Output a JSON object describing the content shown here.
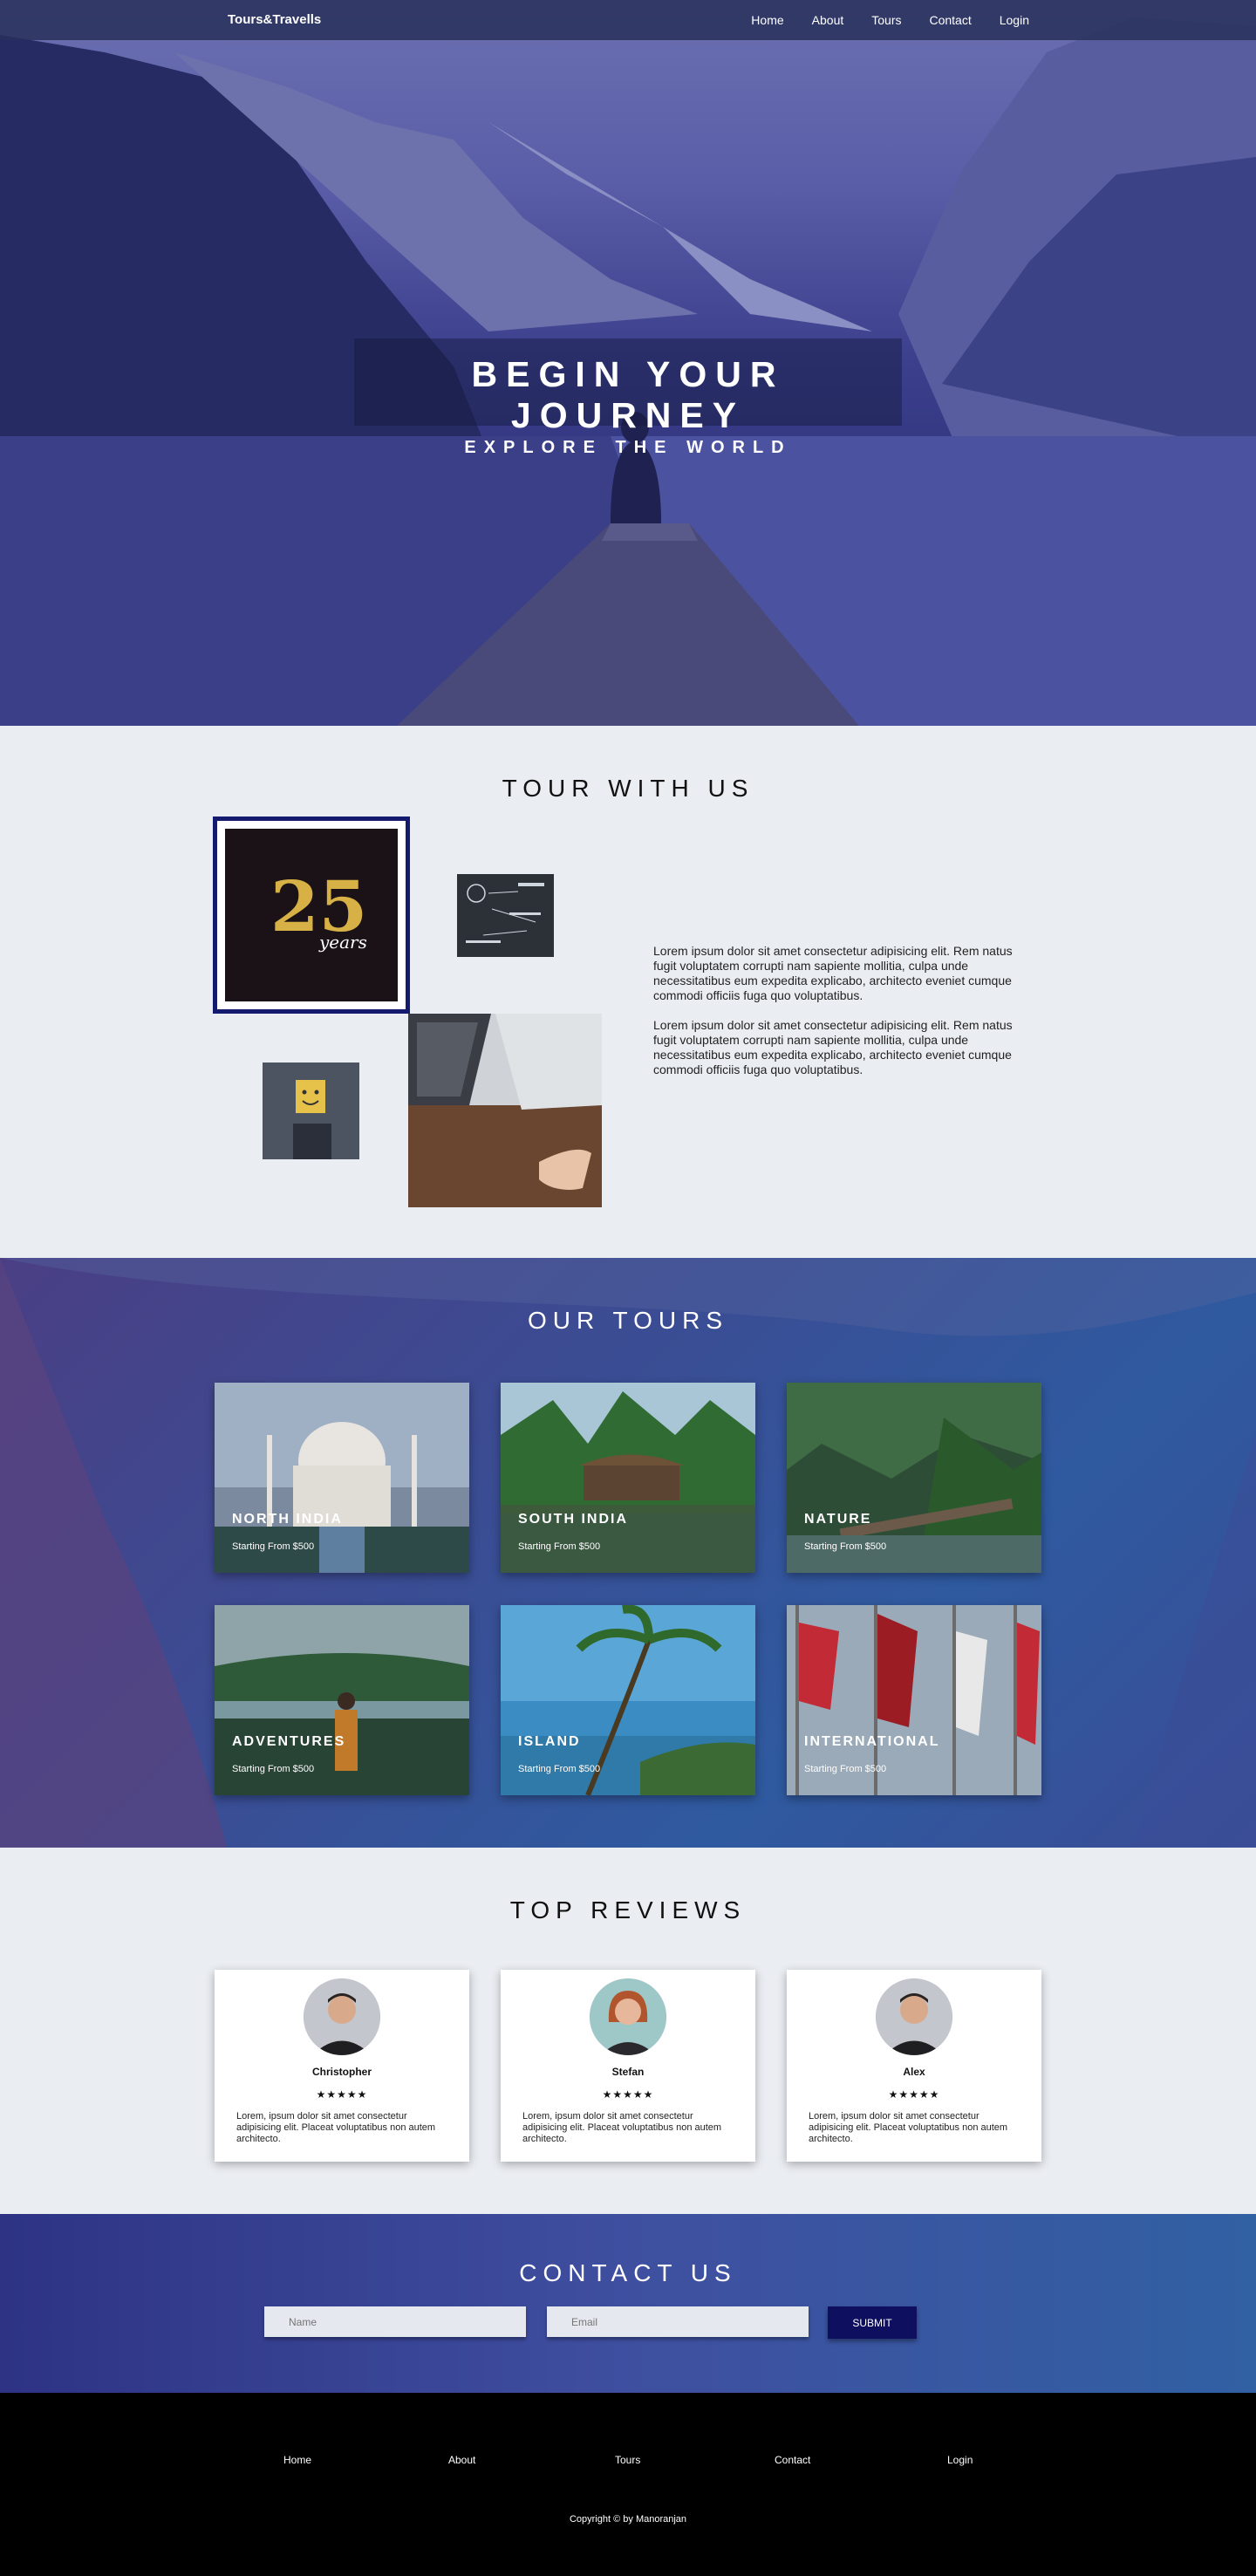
{
  "nav": {
    "brand": "Tours&Travells",
    "links": [
      "Home",
      "About",
      "Tours",
      "Contact",
      "Login"
    ]
  },
  "hero": {
    "title": "BEGIN YOUR JOURNEY",
    "subtitle": "EXPLORE THE WORLD"
  },
  "about": {
    "title": "TOUR WITH US",
    "badge_number": "25",
    "badge_word": "years",
    "paragraphs": [
      "Lorem ipsum dolor sit amet consectetur adipisicing elit. Rem natus fugit voluptatem corrupti nam sapiente mollitia, culpa unde necessitatibus eum expedita explicabo, architecto eveniet cumque commodi officiis fuga quo voluptatibus.",
      "Lorem ipsum dolor sit amet consectetur adipisicing elit. Rem natus fugit voluptatem corrupti nam sapiente mollitia, culpa unde necessitatibus eum expedita explicabo, architecto eveniet cumque commodi officiis fuga quo voluptatibus."
    ]
  },
  "tours": {
    "title": "OUR TOURS",
    "cards": [
      {
        "name": "NORTH INDIA",
        "price": "Starting From $500"
      },
      {
        "name": "SOUTH INDIA",
        "price": "Starting From $500"
      },
      {
        "name": "NATURE",
        "price": "Starting From $500"
      },
      {
        "name": "ADVENTURES",
        "price": "Starting From $500"
      },
      {
        "name": "ISLAND",
        "price": "Starting From $500"
      },
      {
        "name": "INTERNATIONAL",
        "price": "Starting From $500"
      }
    ]
  },
  "reviews": {
    "title": "TOP REVIEWS",
    "items": [
      {
        "name": "Christopher",
        "stars": "★★★★★",
        "text": "Lorem, ipsum dolor sit amet consectetur adipisicing elit. Placeat voluptatibus non autem architecto."
      },
      {
        "name": "Stefan",
        "stars": "★★★★★",
        "text": "Lorem, ipsum dolor sit amet consectetur adipisicing elit. Placeat voluptatibus non autem architecto."
      },
      {
        "name": "Alex",
        "stars": "★★★★★",
        "text": "Lorem, ipsum dolor sit amet consectetur adipisicing elit. Placeat voluptatibus non autem architecto."
      }
    ]
  },
  "contact": {
    "title": "CONTACT US",
    "name_placeholder": "Name",
    "email_placeholder": "Email",
    "submit_label": "SUBMIT"
  },
  "footer": {
    "links": [
      "Home",
      "About",
      "Tours",
      "Contact",
      "Login"
    ],
    "copyright": "Copyright © by Manoranjan"
  }
}
